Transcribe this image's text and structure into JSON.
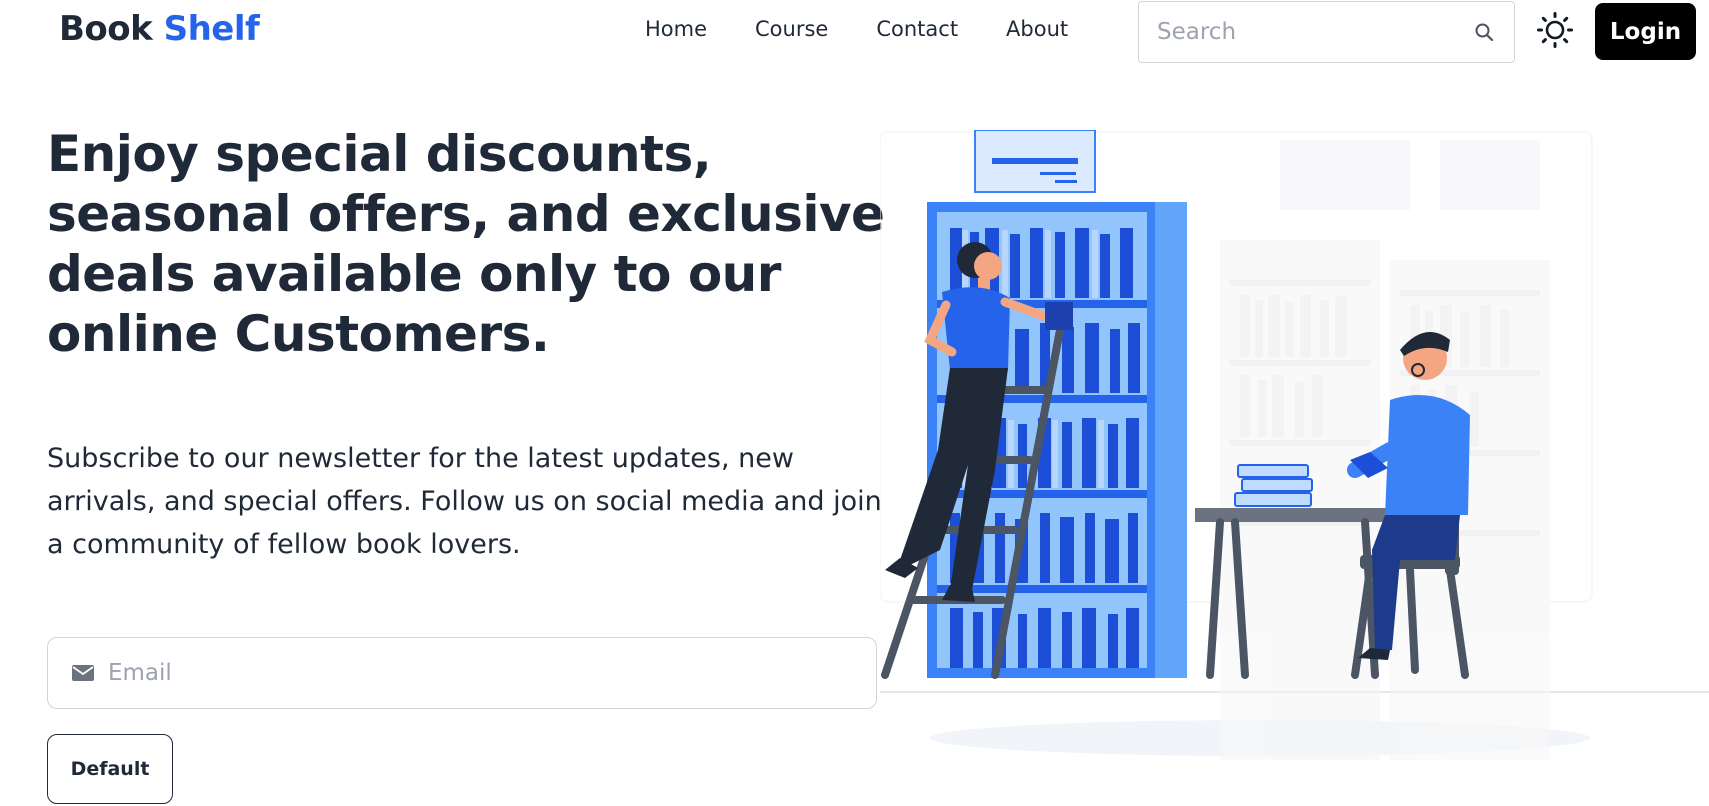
{
  "brand": {
    "name_part1": "Book",
    "name_part2": "Shelf"
  },
  "nav": {
    "items": [
      {
        "label": "Home"
      },
      {
        "label": "Course"
      },
      {
        "label": "Contact"
      },
      {
        "label": "About"
      }
    ]
  },
  "search": {
    "placeholder": "Search",
    "value": ""
  },
  "icons": {
    "search": "search-icon",
    "theme": "sun-icon",
    "email": "mail-icon"
  },
  "auth": {
    "login_label": "Login"
  },
  "hero": {
    "title": "Enjoy special discounts, seasonal offers, and exclusive deals available only to our online Customers.",
    "description": "Subscribe to our newsletter for the latest updates, new arrivals, and special offers. Follow us on social media and join a community of fellow book lovers.",
    "email_placeholder": "Email",
    "email_value": "",
    "button_label": "Default"
  },
  "colors": {
    "accent": "#2563eb",
    "text": "#1f2937",
    "login_bg": "#000000",
    "illustration_blue": "#3b82f6"
  }
}
